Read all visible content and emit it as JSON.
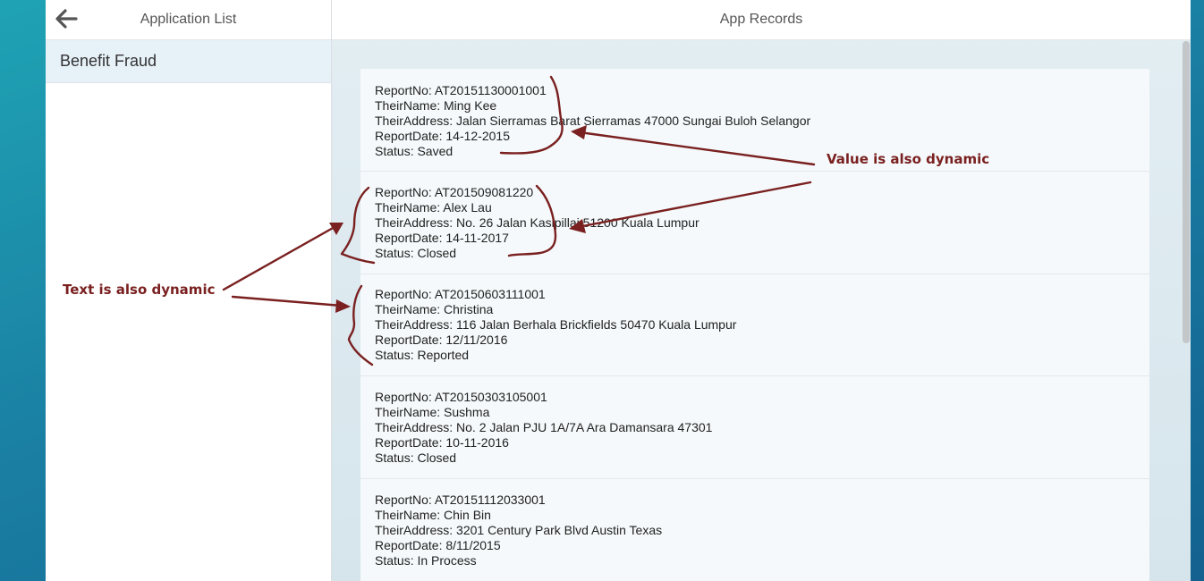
{
  "master": {
    "title": "Application List",
    "items": [
      {
        "label": "Benefit Fraud"
      }
    ]
  },
  "detail": {
    "title": "App Records",
    "records": [
      {
        "report_no": "ReportNo: AT20151130001001",
        "their_name": "TheirName: Ming Kee",
        "their_address": "TheirAddress: Jalan Sierramas Barat Sierramas 47000 Sungai Buloh Selangor",
        "report_date": "ReportDate: 14-12-2015",
        "status": "Status: Saved"
      },
      {
        "report_no": "ReportNo: AT201509081220",
        "their_name": "TheirName: Alex Lau",
        "their_address": "TheirAddress: No. 26 Jalan Kasipillai 51200 Kuala Lumpur",
        "report_date": "ReportDate: 14-11-2017",
        "status": "Status: Closed"
      },
      {
        "report_no": "ReportNo: AT20150603111001",
        "their_name": "TheirName: Christina",
        "their_address": "TheirAddress: 116 Jalan Berhala Brickfields 50470 Kuala Lumpur",
        "report_date": "ReportDate: 12/11/2016",
        "status": "Status: Reported"
      },
      {
        "report_no": "ReportNo: AT20150303105001",
        "their_name": "TheirName: Sushma",
        "their_address": "TheirAddress: No. 2 Jalan PJU 1A/7A Ara Damansara 47301",
        "report_date": "ReportDate: 10-11-2016",
        "status": "Status: Closed"
      },
      {
        "report_no": "ReportNo: AT20151112033001",
        "their_name": "TheirName: Chin Bin",
        "their_address": "TheirAddress: 3201 Century Park Blvd Austin Texas",
        "report_date": "ReportDate: 8/11/2015",
        "status": "Status: In Process"
      }
    ]
  },
  "annotations": {
    "value_note": "Value is also dynamic",
    "text_note": "Text is also dynamic",
    "color": "#7a2020"
  },
  "icons": {
    "back": "back-arrow-icon"
  }
}
